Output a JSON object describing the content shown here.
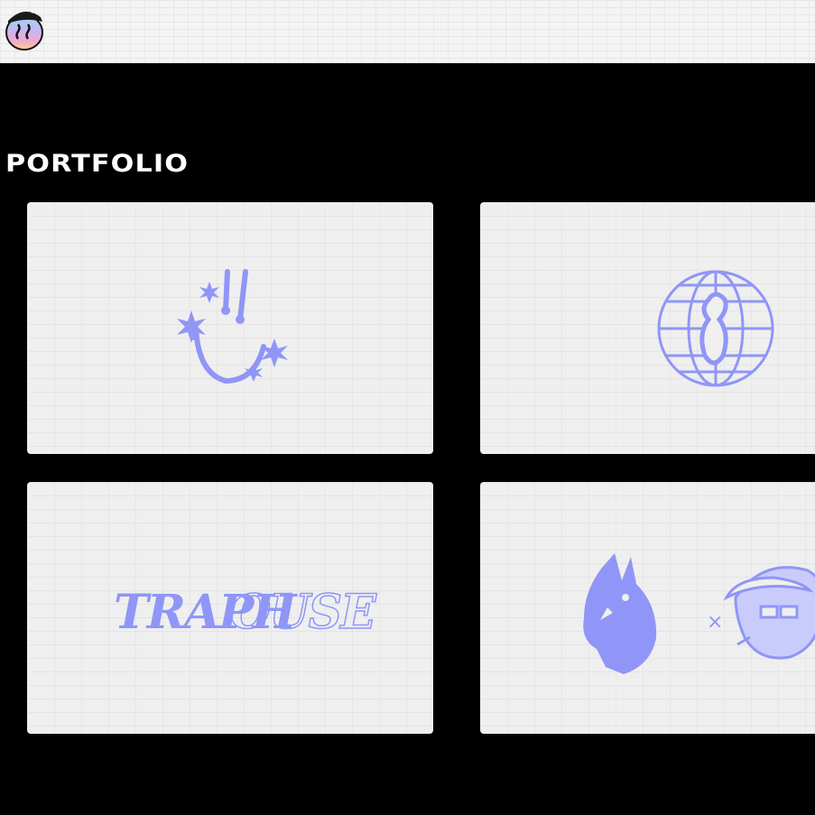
{
  "header": {
    "logo_icon": "smiley-face-with-cap-icon"
  },
  "section": {
    "title": "PORTFOLIO"
  },
  "portfolio": {
    "items": [
      {
        "icon": "smiley-stars-logo-icon"
      },
      {
        "icon": "globe-keyhole-logo-icon"
      },
      {
        "icon": "traphouse-wordmark-icon",
        "text_bold": "TRAPH",
        "text_outline": "OUSE"
      },
      {
        "icon": "wolf-x-character-illustration-icon",
        "separator": "×"
      }
    ]
  },
  "colors": {
    "accent": "#8f96f7",
    "background": "#000000",
    "card": "#efefef"
  }
}
